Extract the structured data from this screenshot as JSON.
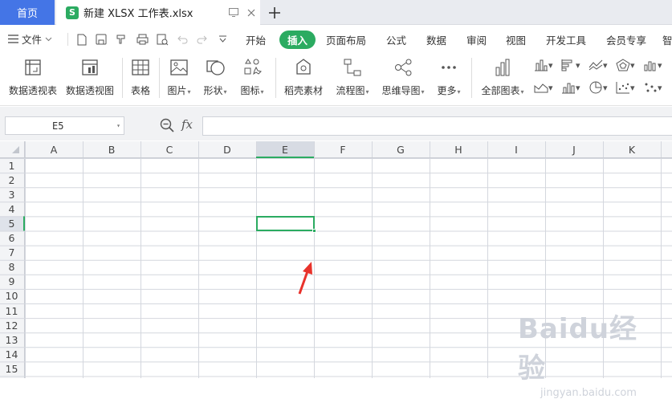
{
  "titlebar": {
    "home_tab": "首页",
    "doc_tab": {
      "logo": "S",
      "title": "新建 XLSX 工作表.xlsx"
    },
    "add_tab_icon": "plus-icon"
  },
  "menubar": {
    "file_label": "文件",
    "tabs": [
      "开始",
      "插入",
      "页面布局",
      "公式",
      "数据",
      "审阅",
      "视图",
      "开发工具",
      "会员专享",
      "智"
    ],
    "active_tab": "插入",
    "accent": "#2bab61"
  },
  "ribbon": {
    "buttons": [
      {
        "label": "数据透视表",
        "icon": "pivot-table-icon"
      },
      {
        "label": "数据透视图",
        "icon": "pivot-chart-icon"
      },
      {
        "label": "表格",
        "icon": "table-icon"
      },
      {
        "label": "图片",
        "icon": "picture-icon"
      },
      {
        "label": "形状",
        "icon": "shape-icon"
      },
      {
        "label": "图标",
        "icon": "icon-library-icon"
      },
      {
        "label": "稻壳素材",
        "icon": "docer-material-icon"
      },
      {
        "label": "流程图",
        "icon": "flowchart-icon"
      },
      {
        "label": "思维导图",
        "icon": "mindmap-icon"
      },
      {
        "label": "更多",
        "icon": "more-icon"
      },
      {
        "label": "全部图表",
        "icon": "all-charts-icon"
      }
    ]
  },
  "formula_bar": {
    "name_box": "E5",
    "fx_label": "fx",
    "formula": ""
  },
  "sheet": {
    "columns": [
      "A",
      "B",
      "C",
      "D",
      "E",
      "F",
      "G",
      "H",
      "I",
      "J",
      "K"
    ],
    "rows": [
      "1",
      "2",
      "3",
      "4",
      "5",
      "6",
      "7",
      "8",
      "9",
      "10",
      "11",
      "12",
      "13",
      "14",
      "15"
    ],
    "selected_cell": "E5",
    "selection_color": "#2bab61",
    "annotation_arrow_color": "#e8322b"
  },
  "watermark": {
    "brand": "Baidu经验",
    "url": "jingyan.baidu.com"
  }
}
